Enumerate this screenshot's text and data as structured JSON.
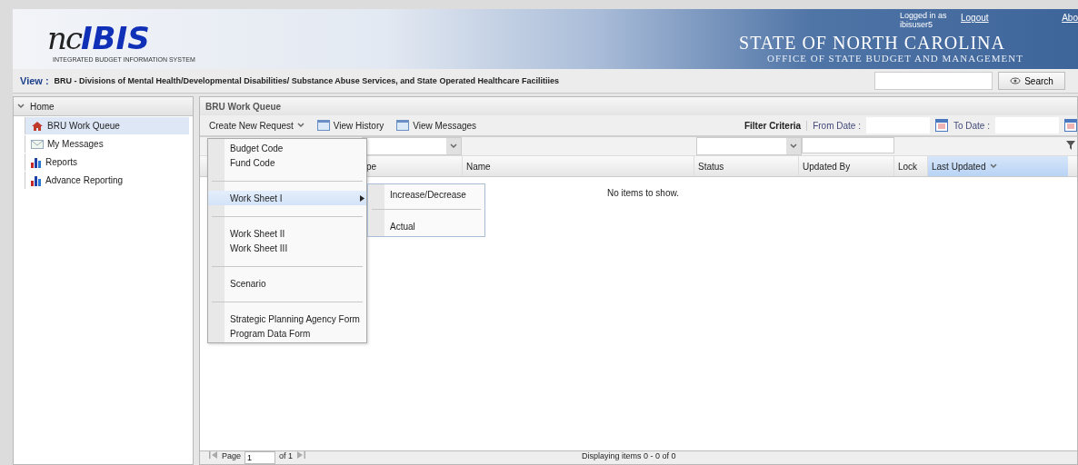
{
  "header": {
    "logo_script": "nc",
    "logo_bold": "IBIS",
    "logo_tagline": "INTEGRATED BUDGET INFORMATION SYSTEM",
    "login_text": "Logged in as ibisuser5",
    "logout": "Logout",
    "about": "Abo",
    "state_title": "STATE OF NORTH CAROLINA",
    "office_title": "OFFICE OF STATE BUDGET AND MANAGEMENT"
  },
  "view_bar": {
    "label": "View :",
    "value": "BRU - Divisions of Mental Health/Developmental Disabilities/ Substance Abuse Services, and State Operated Healthcare Facilitiies",
    "search_button": "Search"
  },
  "sidebar": {
    "title": "Home",
    "expanded": true,
    "items": [
      {
        "label": "BRU Work Queue",
        "kind": "home",
        "selected": true
      },
      {
        "label": "My Messages",
        "kind": "messages",
        "selected": false
      },
      {
        "label": "Reports",
        "kind": "report",
        "selected": false
      },
      {
        "label": "Advance Reporting",
        "kind": "report",
        "selected": false
      }
    ]
  },
  "main": {
    "title": "BRU Work Queue",
    "toolbar": {
      "create": "Create New Request",
      "history": "View History",
      "messages": "View Messages",
      "filter_label": "Filter Criteria",
      "from_label": "From Date :",
      "to_label": "To Date :"
    },
    "columns": [
      {
        "label": "pe",
        "sorted": false
      },
      {
        "label": "Name",
        "sorted": false
      },
      {
        "label": "Status",
        "sorted": false
      },
      {
        "label": "Updated By",
        "sorted": false
      },
      {
        "label": "Lock",
        "sorted": false
      },
      {
        "label": "Last Updated",
        "sorted": true
      }
    ],
    "empty_text": "No items to show.",
    "pager": {
      "page_label": "Page",
      "page_value": "1",
      "of_label": "of 1",
      "display": "Displaying items 0 - 0 of 0"
    }
  },
  "menu": {
    "groups": [
      [
        {
          "label": "Budget Code",
          "selected": false,
          "has_submenu": false
        },
        {
          "label": "Fund Code",
          "selected": false,
          "has_submenu": false
        }
      ],
      [
        {
          "label": "Work Sheet I",
          "selected": true,
          "has_submenu": true
        }
      ],
      [
        {
          "label": "Work Sheet II",
          "selected": false,
          "has_submenu": false
        },
        {
          "label": "Work Sheet III",
          "selected": false,
          "has_submenu": false
        }
      ],
      [
        {
          "label": "Scenario",
          "selected": false,
          "has_submenu": false
        }
      ],
      [
        {
          "label": "Strategic Planning Agency Form",
          "selected": false,
          "has_submenu": false
        },
        {
          "label": "Program Data Form",
          "selected": false,
          "has_submenu": false
        }
      ]
    ]
  },
  "submenu": {
    "groups": [
      [
        {
          "label": "Increase/Decrease",
          "selected": false
        }
      ],
      [
        {
          "label": "Actual",
          "selected": false
        }
      ]
    ]
  }
}
